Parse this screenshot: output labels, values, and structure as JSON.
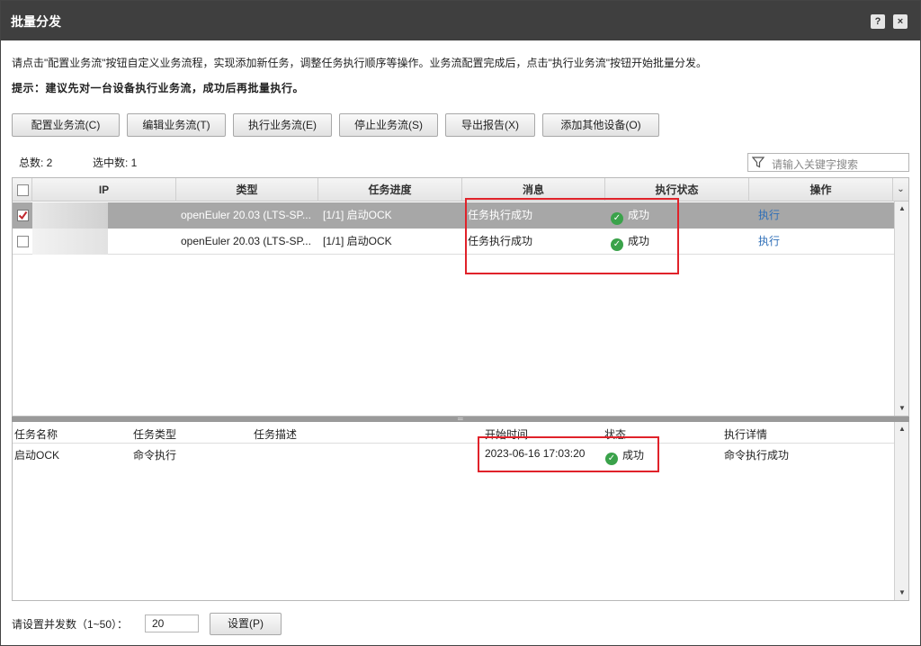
{
  "window": {
    "title": "批量分发",
    "help_label": "?",
    "close_label": "×"
  },
  "description": "请点击\"配置业务流\"按钮自定义业务流程，实现添加新任务，调整任务执行顺序等操作。业务流配置完成后，点击\"执行业务流\"按钮开始批量分发。",
  "hint": "提示：建议先对一台设备执行业务流，成功后再批量执行。",
  "toolbar": {
    "config": "配置业务流(C)",
    "edit": "编辑业务流(T)",
    "run": "执行业务流(E)",
    "stop": "停止业务流(S)",
    "export": "导出报告(X)",
    "add_device": "添加其他设备(O)"
  },
  "counts": {
    "total": "总数: 2",
    "selected": "选中数: 1"
  },
  "search": {
    "placeholder": "请输入关键字搜索",
    "icon": "filter-icon"
  },
  "device_table": {
    "columns": [
      "IP",
      "类型",
      "任务进度",
      "消息",
      "执行状态",
      "操作"
    ],
    "rows": [
      {
        "checked": true,
        "ip": "",
        "type": "openEuler 20.03 (LTS-SP...",
        "progress": "[1/1] 启动OCK",
        "message": "任务执行成功",
        "status": "成功",
        "action": "执行"
      },
      {
        "checked": false,
        "ip": "",
        "type": "openEuler 20.03 (LTS-SP...",
        "progress": "[1/1] 启动OCK",
        "message": "任务执行成功",
        "status": "成功",
        "action": "执行"
      }
    ]
  },
  "task_table": {
    "columns": [
      "任务名称",
      "任务类型",
      "任务描述",
      "开始时间",
      "状态",
      "执行详情"
    ],
    "rows": [
      {
        "name": "启动OCK",
        "type": "命令执行",
        "desc": "",
        "start": "2023-06-16 17:03:20",
        "status": "成功",
        "detail": "命令执行成功"
      }
    ]
  },
  "footer": {
    "concurrency_label": "请设置并发数（1~50）：",
    "concurrency_value": "20",
    "set_button": "设置(P)"
  },
  "colors": {
    "titlebar": "#3f3f3f",
    "success": "#3aa24a",
    "link": "#2f6fb8",
    "highlight_box": "#e0222a",
    "selected_row": "#a7a7a7"
  }
}
